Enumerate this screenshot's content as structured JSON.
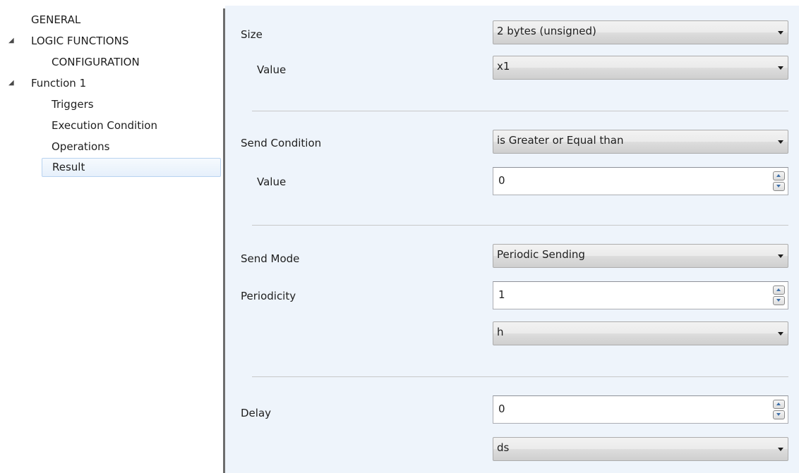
{
  "sidebar": {
    "items": [
      {
        "label": "GENERAL"
      },
      {
        "label": "LOGIC FUNCTIONS",
        "expander": "◢"
      },
      {
        "label": "CONFIGURATION"
      },
      {
        "label": "Function 1",
        "expander": "◢"
      },
      {
        "label": "Triggers"
      },
      {
        "label": "Execution Condition"
      },
      {
        "label": "Operations"
      },
      {
        "label": "Result",
        "selected": true
      }
    ]
  },
  "form": {
    "size": {
      "label": "Size",
      "value": "2 bytes (unsigned)"
    },
    "size_value": {
      "label": "Value",
      "value": "x1"
    },
    "send_condition": {
      "label": "Send Condition",
      "value": "is Greater or Equal than"
    },
    "condition_value": {
      "label": "Value",
      "value": "0"
    },
    "send_mode": {
      "label": "Send Mode",
      "value": "Periodic Sending"
    },
    "periodicity": {
      "label": "Periodicity",
      "value": "1",
      "unit": "h"
    },
    "delay": {
      "label": "Delay",
      "value": "0",
      "unit": "ds"
    }
  },
  "colors": {
    "content_background": "#eef4fb",
    "selection_border": "#b8d3f0",
    "spin_arrow": "#3c6ea8"
  }
}
